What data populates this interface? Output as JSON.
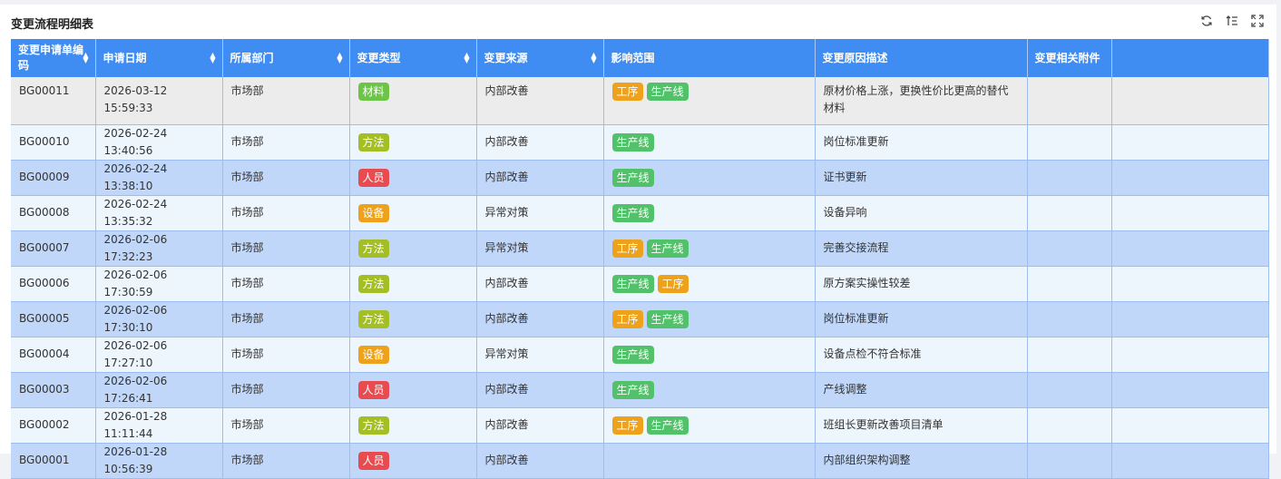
{
  "page": {
    "title": "变更流程明细表"
  },
  "toolbar": {
    "refresh_icon": "refresh-icon",
    "sort_icon": "sort-lines-icon",
    "fullscreen_icon": "fullscreen-icon"
  },
  "colors": {
    "header": "#3f8cf2",
    "row_dark": "#c0d7f9",
    "row_light": "#edf5fd",
    "tag_材料": "#6cc547",
    "tag_方法": "#a3bf25",
    "tag_人员": "#e84c50",
    "tag_设备": "#eea21c",
    "tag_工序": "#eea21c",
    "tag_生产线": "#52c26a"
  },
  "table": {
    "columns": [
      {
        "label": "变更申请单编码",
        "sortable": true
      },
      {
        "label": "申请日期",
        "sortable": true
      },
      {
        "label": "所属部门",
        "sortable": true
      },
      {
        "label": "变更类型",
        "sortable": true
      },
      {
        "label": "变更来源",
        "sortable": true
      },
      {
        "label": "影响范围",
        "sortable": false
      },
      {
        "label": "变更原因描述",
        "sortable": false
      },
      {
        "label": "变更相关附件",
        "sortable": false
      },
      {
        "label": "",
        "sortable": false
      }
    ],
    "rows": [
      {
        "code": "BG00011",
        "date": "2026-03-12 15:59:33",
        "dept": "市场部",
        "type": "材料",
        "source": "内部改善",
        "scope": [
          "工序",
          "生产线"
        ],
        "reason": "原材价格上涨，更换性价比更高的替代材料",
        "attachment": ""
      },
      {
        "code": "BG00010",
        "date": "2026-02-24 13:40:56",
        "dept": "市场部",
        "type": "方法",
        "source": "内部改善",
        "scope": [
          "生产线"
        ],
        "reason": "岗位标准更新",
        "attachment": ""
      },
      {
        "code": "BG00009",
        "date": "2026-02-24 13:38:10",
        "dept": "市场部",
        "type": "人员",
        "source": "内部改善",
        "scope": [
          "生产线"
        ],
        "reason": "证书更新",
        "attachment": ""
      },
      {
        "code": "BG00008",
        "date": "2026-02-24 13:35:32",
        "dept": "市场部",
        "type": "设备",
        "source": "异常对策",
        "scope": [
          "生产线"
        ],
        "reason": "设备异响",
        "attachment": ""
      },
      {
        "code": "BG00007",
        "date": "2026-02-06 17:32:23",
        "dept": "市场部",
        "type": "方法",
        "source": "异常对策",
        "scope": [
          "工序",
          "生产线"
        ],
        "reason": "完善交接流程",
        "attachment": ""
      },
      {
        "code": "BG00006",
        "date": "2026-02-06 17:30:59",
        "dept": "市场部",
        "type": "方法",
        "source": "内部改善",
        "scope": [
          "生产线",
          "工序"
        ],
        "reason": "原方案实操性较差",
        "attachment": ""
      },
      {
        "code": "BG00005",
        "date": "2026-02-06 17:30:10",
        "dept": "市场部",
        "type": "方法",
        "source": "内部改善",
        "scope": [
          "工序",
          "生产线"
        ],
        "reason": "岗位标准更新",
        "attachment": ""
      },
      {
        "code": "BG00004",
        "date": "2026-02-06 17:27:10",
        "dept": "市场部",
        "type": "设备",
        "source": "异常对策",
        "scope": [
          "生产线"
        ],
        "reason": "设备点检不符合标准",
        "attachment": ""
      },
      {
        "code": "BG00003",
        "date": "2026-02-06 17:26:41",
        "dept": "市场部",
        "type": "人员",
        "source": "内部改善",
        "scope": [
          "生产线"
        ],
        "reason": "产线调整",
        "attachment": ""
      },
      {
        "code": "BG00002",
        "date": "2026-01-28 11:11:44",
        "dept": "市场部",
        "type": "方法",
        "source": "内部改善",
        "scope": [
          "工序",
          "生产线"
        ],
        "reason": "班组长更新改善项目清单",
        "attachment": ""
      },
      {
        "code": "BG00001",
        "date": "2026-01-28 10:56:39",
        "dept": "市场部",
        "type": "人员",
        "source": "内部改善",
        "scope": [],
        "reason": "内部组织架构调整",
        "attachment": ""
      }
    ]
  }
}
